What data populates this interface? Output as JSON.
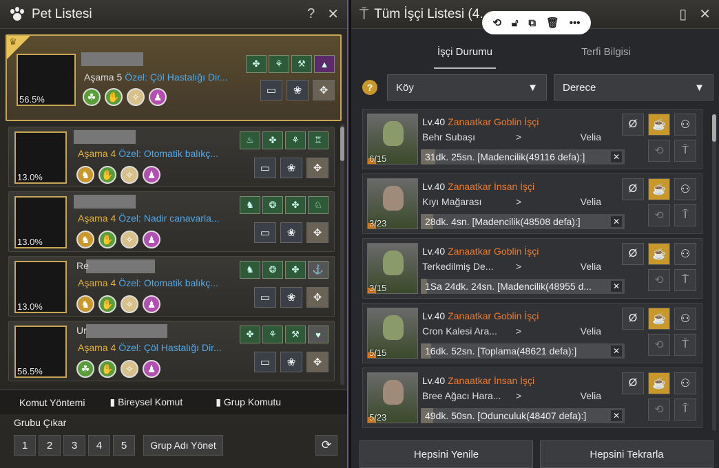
{
  "pet_window": {
    "title": "Pet Listesi",
    "help": "?",
    "close": "✕",
    "pets": [
      {
        "pct": "56.5%",
        "stage": "Aşama 5",
        "special": "Özel: Çöl Hastalığı Dir..."
      },
      {
        "pct": "13.0%",
        "stage": "Aşama 4",
        "special": "Özel: Otomatik balıkç..."
      },
      {
        "pct": "13.0%",
        "stage": "Aşama 4",
        "special": "Özel: Nadir canavarla..."
      },
      {
        "pct": "13.0%",
        "stage": "Aşama 4",
        "special": "Özel: Otomatik balıkç...",
        "name_prefix": "Re"
      },
      {
        "pct": "56.5%",
        "stage": "Aşama 4",
        "special": "Özel: Çöl Hastalığı Dir...",
        "name_prefix": "Ur"
      }
    ],
    "command_method": "Komut Yöntemi",
    "individual_command": "Bireysel Komut",
    "group_command": "Grup Komutu",
    "remove_group": "Grubu Çıkar",
    "group_buttons": [
      "1",
      "2",
      "3",
      "4",
      "5"
    ],
    "manage_group_name": "Grup Adı Yönet"
  },
  "worker_window": {
    "title": "Tüm İşçi Listesi (4...",
    "tabs": [
      "İşçi Durumu",
      "Terfi Bilgisi"
    ],
    "filter_region": "Köy",
    "filter_grade": "Derece",
    "workers": [
      {
        "level": "Lv.40",
        "type": "Zanaatkar Goblin İşçi",
        "location": "Behr Subaşı",
        "arrow": ">",
        "region": "Velia",
        "count": "6/15",
        "task": "31dk. 25sn. [Madencilik(49116 defa):]",
        "kind": "goblin",
        "progress": 0.07
      },
      {
        "level": "Lv.40",
        "type": "Zanaatkar İnsan İşçi",
        "location": "Kıyı Mağarası",
        "arrow": ">",
        "region": "Velia",
        "count": "3/23",
        "task": "28dk. 4sn. [Madencilik(48508 defa):]",
        "kind": "human",
        "progress": 0.06
      },
      {
        "level": "Lv.40",
        "type": "Zanaatkar Goblin İşçi",
        "location": "Terkedilmiş De...",
        "arrow": ">",
        "region": "Velia",
        "count": "3/15",
        "task": "1Sa 24dk. 24sn. [Madencilik(48955 d...",
        "kind": "goblin",
        "progress": 0.03
      },
      {
        "level": "Lv.40",
        "type": "Zanaatkar Goblin İşçi",
        "location": "Cron Kalesi Ara...",
        "arrow": ">",
        "region": "Velia",
        "count": "5/15",
        "task": "16dk. 52sn. [Toplama(48621 defa):]",
        "kind": "goblin",
        "progress": 0.05
      },
      {
        "level": "Lv.40",
        "type": "Zanaatkar İnsan İşçi",
        "location": "Bree Ağacı Hara...",
        "arrow": ">",
        "region": "Velia",
        "count": "5/23",
        "task": "49dk. 50sn. [Odunculuk(48407 defa):]",
        "kind": "human",
        "progress": 0.06
      }
    ],
    "refresh_all": "Hepsini Yenile",
    "repeat_all": "Hepsini Tekrarla"
  }
}
